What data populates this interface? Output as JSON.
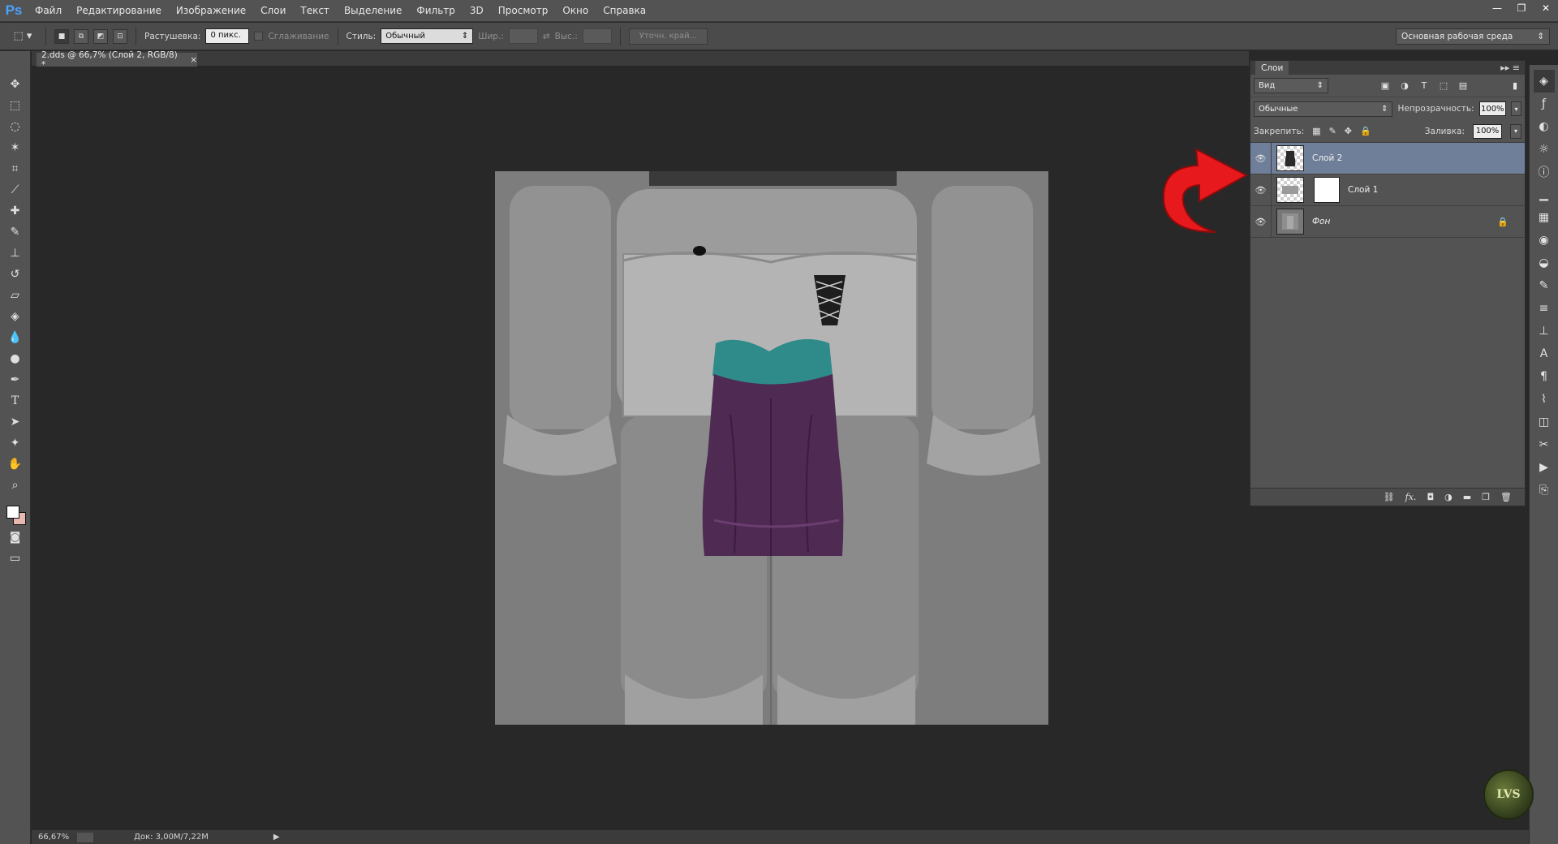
{
  "app": {
    "logo": "Ps"
  },
  "menu": [
    "Файл",
    "Редактирование",
    "Изображение",
    "Слои",
    "Текст",
    "Выделение",
    "Фильтр",
    "3D",
    "Просмотр",
    "Окно",
    "Справка"
  ],
  "options": {
    "feather_label": "Растушевка:",
    "feather_value": "0 пикс.",
    "antialias_label": "Сглаживание",
    "style_label": "Стиль:",
    "style_value": "Обычный",
    "width_label": "Шир.:",
    "height_label": "Выс.:",
    "refine_edge": "Уточн. край...",
    "workspace": "Основная рабочая среда"
  },
  "document": {
    "tab_title": "2.dds @ 66,7% (Слой 2, RGB/8) *"
  },
  "status": {
    "zoom": "66,67%",
    "doc_info": "Док: 3,00M/7,22M"
  },
  "layers_panel": {
    "title": "Слои",
    "filter": "Вид",
    "blend_mode": "Обычные",
    "opacity_label": "Непрозрачность:",
    "opacity_value": "100%",
    "lock_label": "Закрепить:",
    "fill_label": "Заливка:",
    "fill_value": "100%",
    "layers": [
      {
        "name": "Слой 2",
        "selected": true
      },
      {
        "name": "Слой 1",
        "selected": false
      },
      {
        "name": "Фон",
        "selected": false,
        "locked": true
      }
    ]
  },
  "watermark": {
    "text": "LVS"
  },
  "colors": {
    "accent": "#4aa3ff",
    "selected_layer": "#6f7f99",
    "foreground": "#ffffff",
    "background": "#e7b9ae",
    "arrow": "#e8191c"
  }
}
